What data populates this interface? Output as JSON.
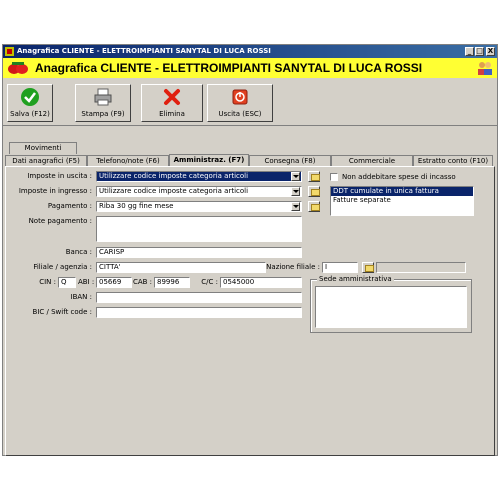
{
  "window": {
    "title": "Anagrafica CLIENTE - ELETTROIMPIANTI SANYTAL DI LUCA ROSSI",
    "header_title": "Anagrafica CLIENTE - ELETTROIMPIANTI SANYTAL DI LUCA ROSSI",
    "controls": {
      "minimize": "_",
      "maximize": "□",
      "close": "X"
    }
  },
  "toolbar": {
    "save": {
      "label": "Salva (F12)",
      "icon": "checkmark-icon"
    },
    "print": {
      "label": "Stampa (F9)",
      "icon": "printer-icon"
    },
    "delete": {
      "label": "Elimina",
      "icon": "delete-x-icon"
    },
    "exit": {
      "label": "Uscita (ESC)",
      "icon": "power-icon"
    }
  },
  "tabs_top": [
    {
      "label": "Movimenti"
    }
  ],
  "tabs": [
    {
      "label": "Dati anagrafici (F5)"
    },
    {
      "label": "Telefono/note (F6)"
    },
    {
      "label": "Amministraz. (F7)",
      "active": true
    },
    {
      "label": "Consegna (F8)"
    },
    {
      "label": "Commerciale"
    },
    {
      "label": "Estratto conto (F10)"
    }
  ],
  "form": {
    "imposte_uscita": {
      "label": "Imposte in uscita :",
      "value": "Utilizzare codice imposte categoria articoli"
    },
    "imposte_ingresso": {
      "label": "Imposte in ingresso :",
      "value": "Utilizzare codice imposte categoria articoli"
    },
    "pagamento": {
      "label": "Pagamento :",
      "value": "Riba 30 gg fine mese"
    },
    "note_pagamento": {
      "label": "Note pagamento :",
      "value": ""
    },
    "banca": {
      "label": "Banca :",
      "value": "CARISP"
    },
    "filiale": {
      "label": "Filiale / agenzia :",
      "value": "CITTA'"
    },
    "nazione_filiale": {
      "label": "Nazione filiale :",
      "value": "I"
    },
    "cin": {
      "label": "CIN :",
      "value": "Q"
    },
    "abi": {
      "label": "ABI :",
      "value": "05669"
    },
    "cab": {
      "label": "CAB :",
      "value": "89996"
    },
    "cc": {
      "label": "C/C :",
      "value": "0545000"
    },
    "iban": {
      "label": "IBAN :",
      "value": ""
    },
    "bic": {
      "label": "BIC / Swift code :",
      "value": ""
    },
    "non_addebitare": {
      "label": "Non addebitare spese di incasso",
      "checked": false
    },
    "fatturazione_options": [
      {
        "label": "DDT cumulate in unica fattura",
        "selected": true
      },
      {
        "label": "Fatture separate",
        "selected": false
      }
    ],
    "sede_amministrativa": {
      "label": "Sede amministrativa",
      "value": ""
    }
  }
}
